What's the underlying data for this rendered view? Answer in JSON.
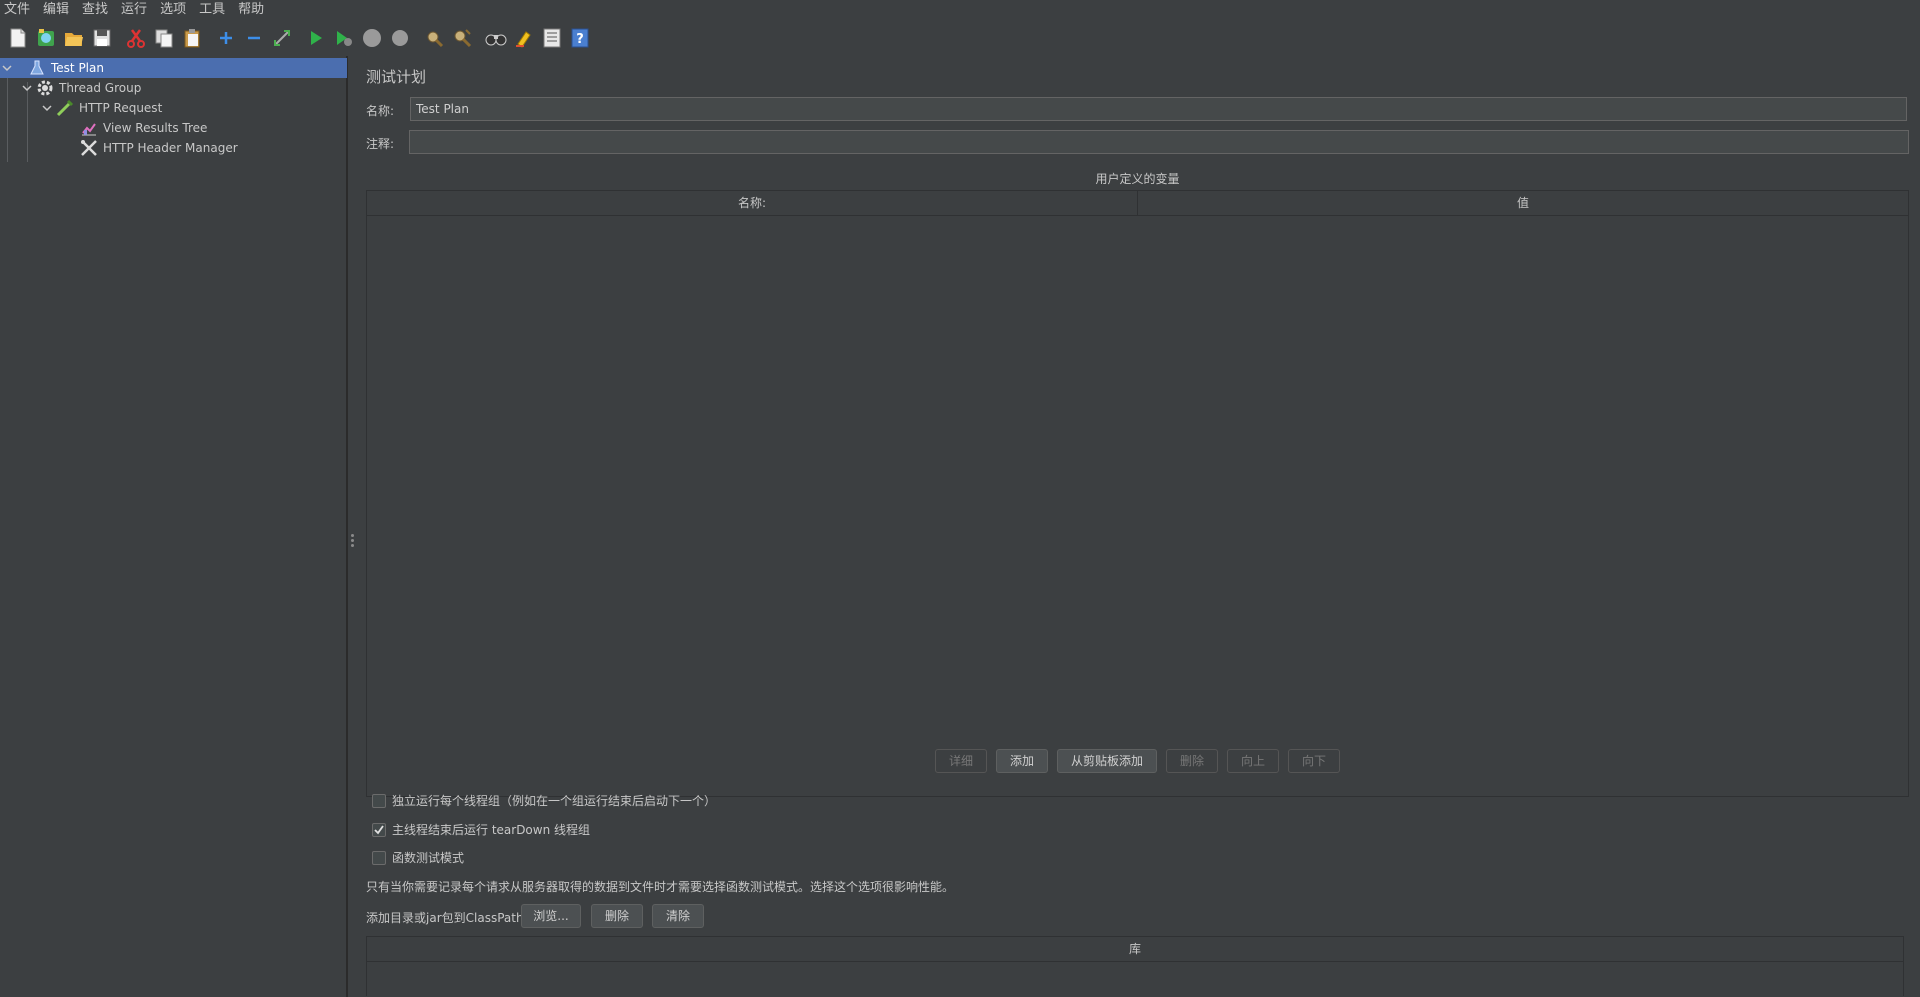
{
  "menu": [
    "文件",
    "编辑",
    "查找",
    "运行",
    "选项",
    "工具",
    "帮助"
  ],
  "toolbar": {
    "icons": [
      "new-icon",
      "templates-icon",
      "open-icon",
      "save-icon",
      "cut-icon",
      "copy-icon",
      "paste-icon",
      "expand-icon",
      "collapse-icon",
      "toggle-icon",
      "start-icon",
      "start-no-pause-icon",
      "stop-icon",
      "shutdown-icon",
      "clear-icon",
      "clear-all-icon",
      "search-icon",
      "reset-search-icon",
      "function-helper-icon",
      "help-icon"
    ]
  },
  "tree": {
    "items": [
      {
        "label": "Test Plan",
        "level": 0,
        "selected": true
      },
      {
        "label": "Thread Group",
        "level": 1,
        "selected": false
      },
      {
        "label": "HTTP Request",
        "level": 2,
        "selected": false
      },
      {
        "label": "View Results Tree",
        "level": 3,
        "selected": false
      },
      {
        "label": "HTTP Header Manager",
        "level": 3,
        "selected": false
      }
    ]
  },
  "panel": {
    "title": "测试计划",
    "name_label": "名称:",
    "name_value": "Test Plan",
    "comment_label": "注释:",
    "comment_value": ""
  },
  "variables": {
    "caption": "用户定义的变量",
    "columns": [
      "名称:",
      "值"
    ],
    "rows": []
  },
  "var_buttons": {
    "detail": "详细",
    "add": "添加",
    "add_from_clipboard": "从剪贴板添加",
    "delete": "删除",
    "up": "向上",
    "down": "向下"
  },
  "options": {
    "serialize": {
      "label": "独立运行每个线程组（例如在一个组运行结束后启动下一个）",
      "checked": false
    },
    "teardown": {
      "label": "主线程结束后运行 tearDown 线程组",
      "checked": true
    },
    "functional": {
      "label": "函数测试模式",
      "checked": false
    },
    "functional_note": "只有当你需要记录每个请求从服务器取得的数据到文件时才需要选择函数测试模式。选择这个选项很影响性能。"
  },
  "classpath": {
    "label": "添加目录或jar包到ClassPath",
    "browse": "浏览...",
    "delete": "删除",
    "clear": "清除",
    "column": "库"
  }
}
